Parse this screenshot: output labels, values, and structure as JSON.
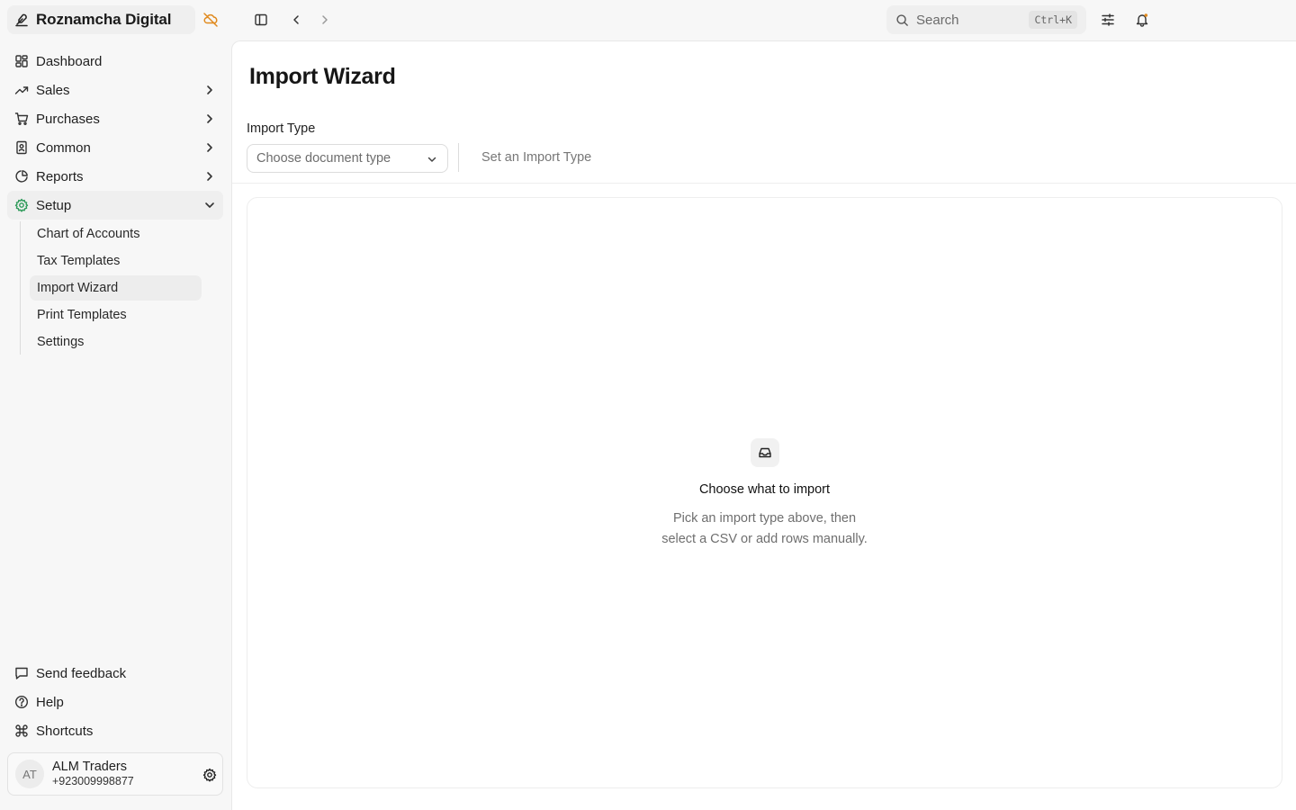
{
  "app": {
    "title": "Roznamcha Digital"
  },
  "sidebar": {
    "items": [
      {
        "label": "Dashboard",
        "icon": "dashboard-icon",
        "has_children": false
      },
      {
        "label": "Sales",
        "icon": "trending-up-icon",
        "has_children": true
      },
      {
        "label": "Purchases",
        "icon": "cart-icon",
        "has_children": true
      },
      {
        "label": "Common",
        "icon": "book-icon",
        "has_children": true
      },
      {
        "label": "Reports",
        "icon": "pie-chart-icon",
        "has_children": true
      },
      {
        "label": "Setup",
        "icon": "gear-icon",
        "has_children": true,
        "expanded": true
      }
    ],
    "setup_children": [
      {
        "label": "Chart of Accounts"
      },
      {
        "label": "Tax Templates"
      },
      {
        "label": "Import Wizard",
        "active": true
      },
      {
        "label": "Print Templates"
      },
      {
        "label": "Settings"
      }
    ],
    "bottom_items": [
      {
        "label": "Send feedback",
        "icon": "message-icon"
      },
      {
        "label": "Help",
        "icon": "help-icon"
      },
      {
        "label": "Shortcuts",
        "icon": "command-icon"
      }
    ],
    "user": {
      "initials": "AT",
      "name": "ALM Traders",
      "phone": "+923009998877"
    }
  },
  "topbar": {
    "search": {
      "placeholder": "Search",
      "shortcut": "Ctrl+K"
    }
  },
  "main": {
    "title": "Import Wizard",
    "import_type": {
      "label": "Import Type",
      "placeholder": "Choose document type",
      "hint": "Set an Import Type"
    },
    "empty_state": {
      "title": "Choose what to import",
      "line1": "Pick an import type above, then",
      "line2": "select a CSV or add rows manually."
    }
  },
  "colors": {
    "accent_orange": "#e08a1e",
    "setup_green": "#2e9a5a",
    "sidebar_bg": "#f7f7f7",
    "panel_bg": "#ffffff"
  }
}
